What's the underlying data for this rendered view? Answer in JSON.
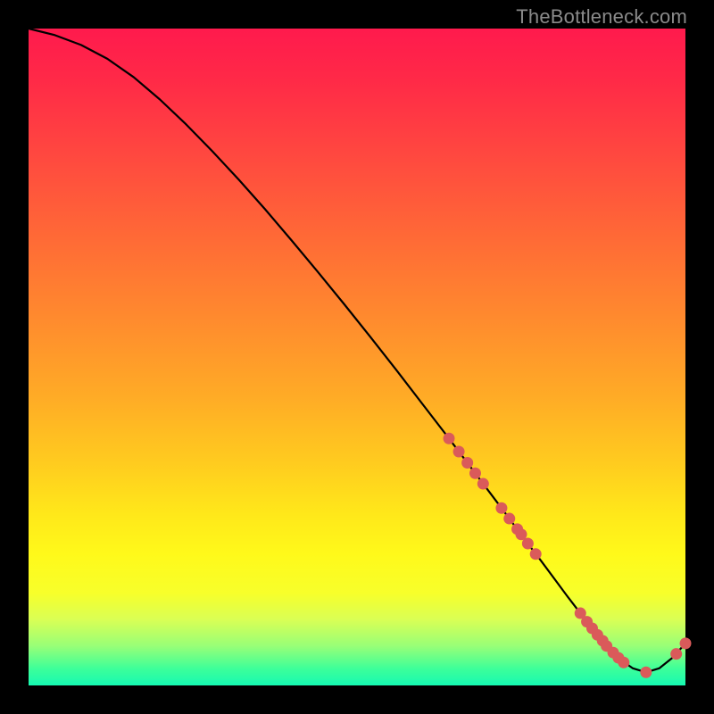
{
  "watermark": "TheBottleneck.com",
  "chart_data": {
    "type": "line",
    "title": "",
    "xlabel": "",
    "ylabel": "",
    "xlim": [
      0,
      100
    ],
    "ylim": [
      0,
      100
    ],
    "series": [
      {
        "name": "curve",
        "x": [
          0,
          4,
          8,
          12,
          16,
          20,
          24,
          28,
          32,
          36,
          40,
          44,
          48,
          52,
          56,
          60,
          64,
          68,
          72,
          74,
          76,
          78,
          80,
          82,
          84,
          86,
          88,
          90,
          92,
          94,
          96,
          98,
          100
        ],
        "y": [
          100,
          99.0,
          97.5,
          95.4,
          92.6,
          89.2,
          85.4,
          81.3,
          77.0,
          72.5,
          67.8,
          63.0,
          58.1,
          53.1,
          48.0,
          42.8,
          37.6,
          32.3,
          27.0,
          24.3,
          21.6,
          19.0,
          16.3,
          13.6,
          11.0,
          8.4,
          6.0,
          4.0,
          2.6,
          2.0,
          2.6,
          4.2,
          6.4
        ]
      }
    ],
    "markers": [
      {
        "name": "dots",
        "color": "#da5a5a",
        "points": [
          {
            "x": 64.0,
            "y": 37.6
          },
          {
            "x": 65.5,
            "y": 35.6
          },
          {
            "x": 66.8,
            "y": 33.9
          },
          {
            "x": 68.0,
            "y": 32.3
          },
          {
            "x": 69.2,
            "y": 30.7
          },
          {
            "x": 72.0,
            "y": 27.0
          },
          {
            "x": 73.2,
            "y": 25.4
          },
          {
            "x": 74.4,
            "y": 23.8
          },
          {
            "x": 75.0,
            "y": 23.0
          },
          {
            "x": 76.0,
            "y": 21.6
          },
          {
            "x": 77.2,
            "y": 20.0
          },
          {
            "x": 84.0,
            "y": 11.0
          },
          {
            "x": 85.0,
            "y": 9.7
          },
          {
            "x": 85.8,
            "y": 8.7
          },
          {
            "x": 86.6,
            "y": 7.7
          },
          {
            "x": 87.4,
            "y": 6.8
          },
          {
            "x": 88.0,
            "y": 6.0
          },
          {
            "x": 89.0,
            "y": 5.0
          },
          {
            "x": 89.8,
            "y": 4.2
          },
          {
            "x": 90.6,
            "y": 3.5
          },
          {
            "x": 94.0,
            "y": 2.0
          },
          {
            "x": 98.6,
            "y": 4.8
          },
          {
            "x": 100.0,
            "y": 6.4
          }
        ]
      }
    ]
  }
}
